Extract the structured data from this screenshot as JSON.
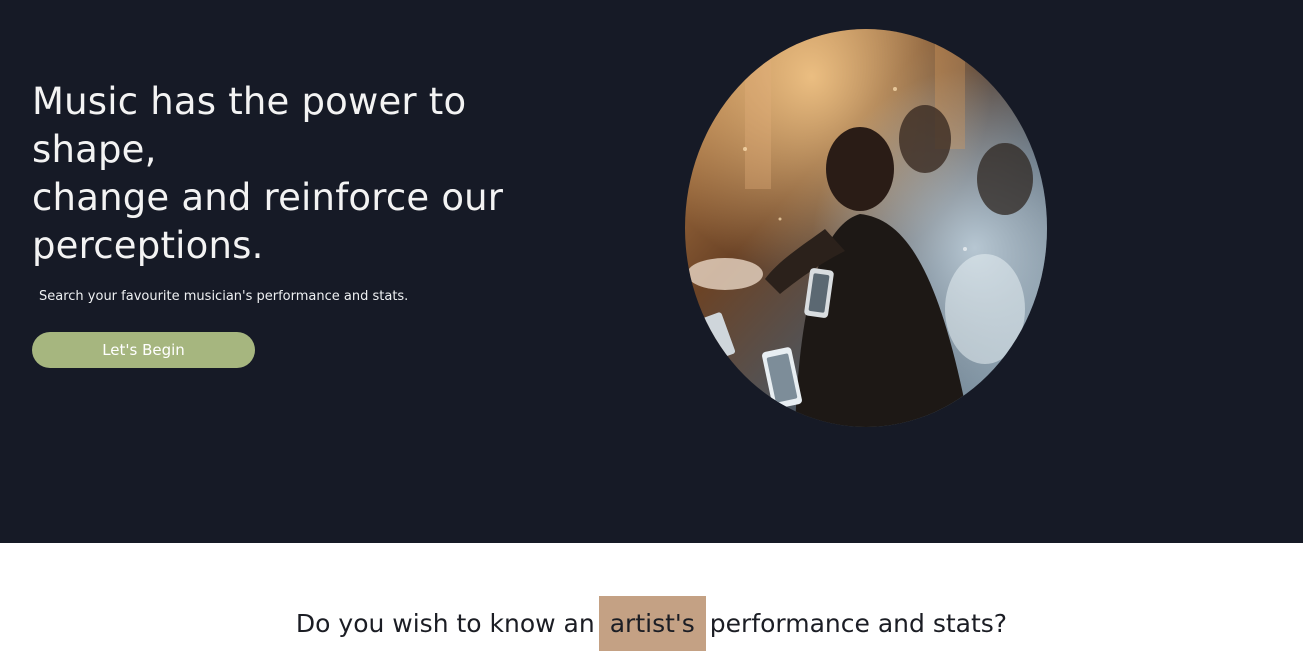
{
  "hero": {
    "headline_line1": "Music has the power to",
    "headline_line2": "shape,",
    "headline_line3": "change and reinforce our",
    "headline_line4": "perceptions.",
    "subtitle": "Search your favourite musician's performance and stats.",
    "cta_label": "Let's Begin",
    "image_alt": "Concert performer photo",
    "colors": {
      "background": "#161a26",
      "cta": "#a6b67f",
      "text": "#f3f3f3"
    }
  },
  "lower": {
    "question_before": "Do you wish to know an",
    "question_highlight": "artist's",
    "question_after": "performance and stats?",
    "colors": {
      "highlight": "#c4a184",
      "text": "#1b1d24"
    }
  }
}
